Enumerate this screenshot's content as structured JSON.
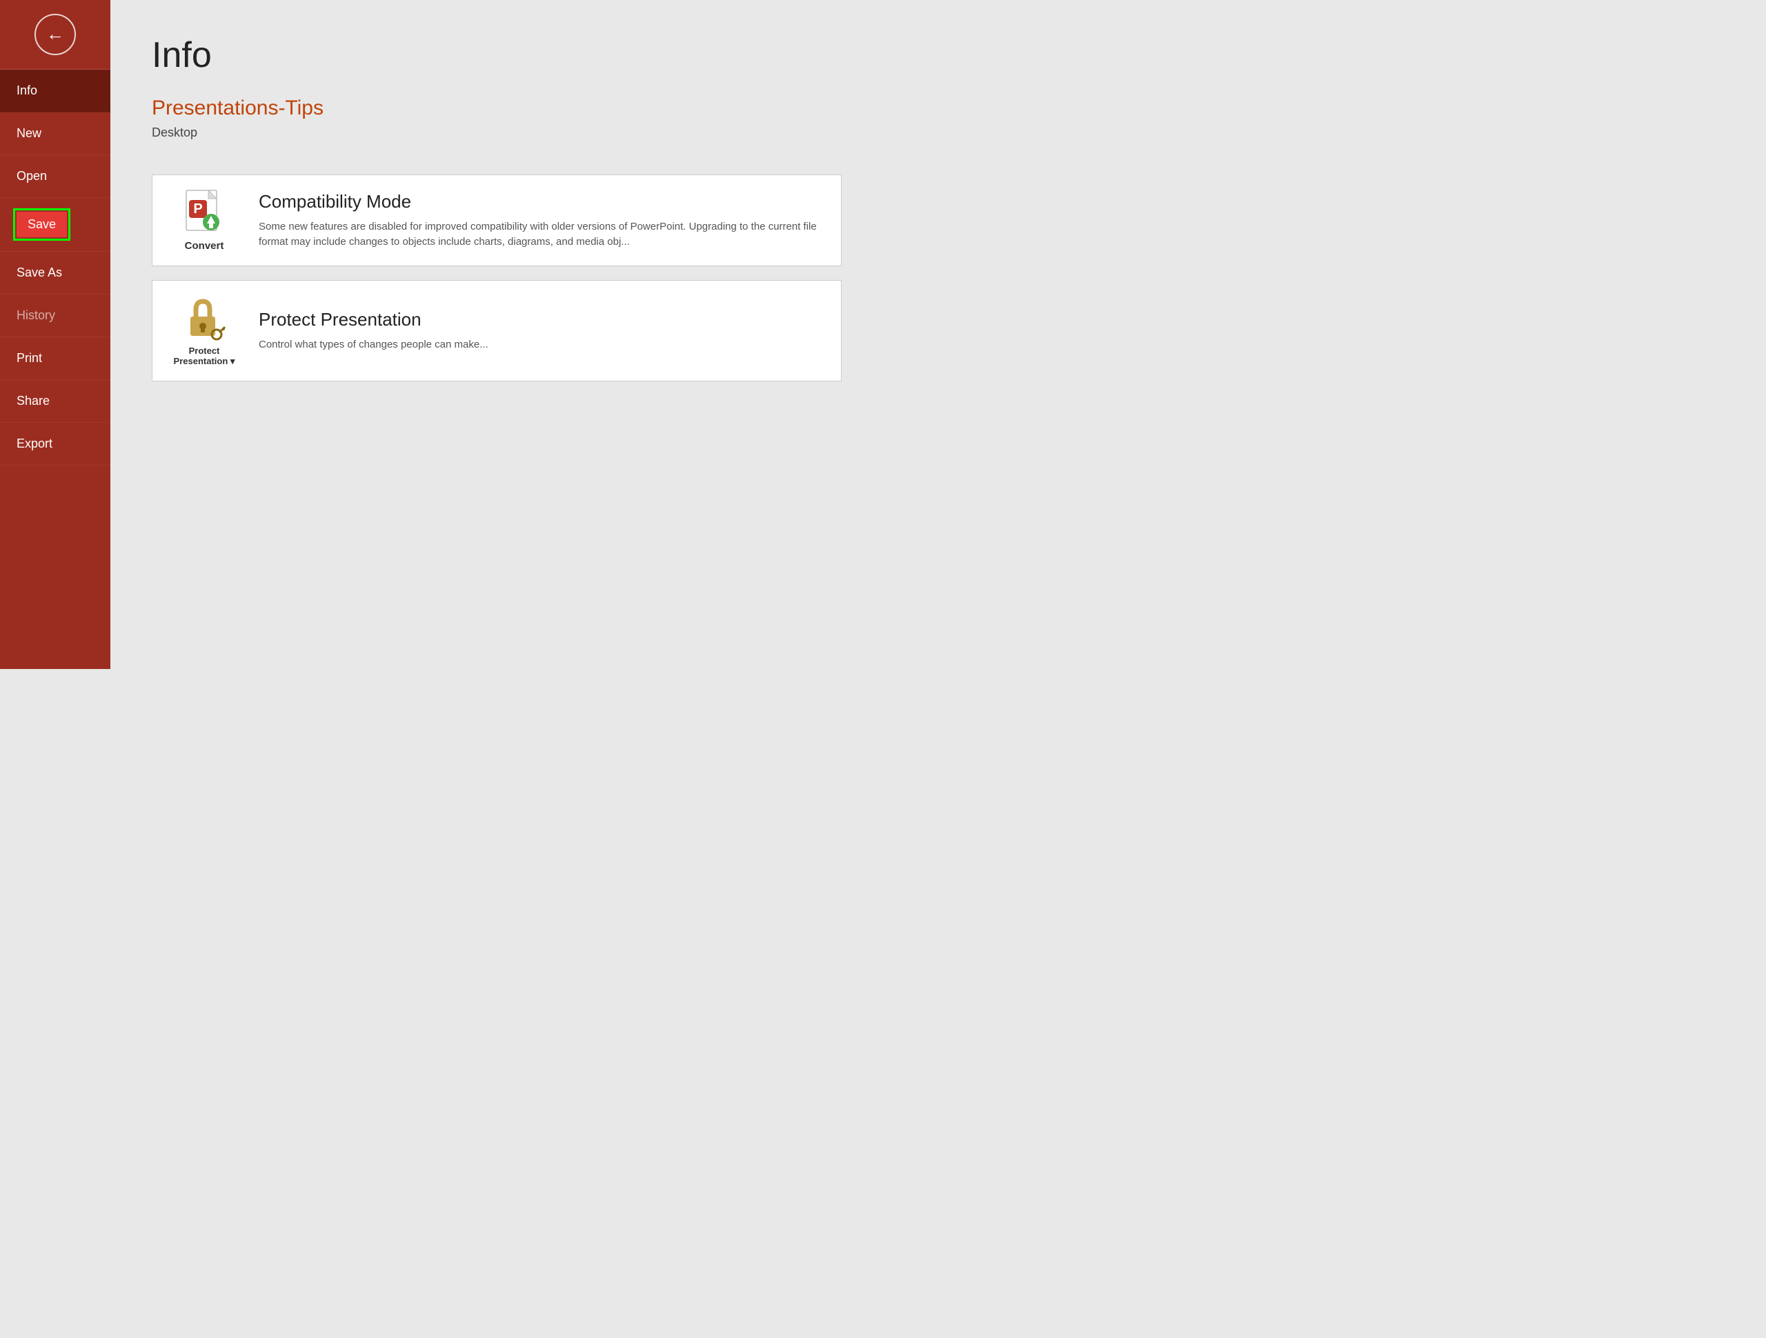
{
  "sidebar": {
    "back_button_label": "←",
    "nav_items": [
      {
        "id": "info",
        "label": "Info",
        "state": "active"
      },
      {
        "id": "new",
        "label": "New",
        "state": "normal"
      },
      {
        "id": "open",
        "label": "Open",
        "state": "normal"
      },
      {
        "id": "save",
        "label": "Save",
        "state": "highlighted"
      },
      {
        "id": "save-as",
        "label": "Save As",
        "state": "normal"
      },
      {
        "id": "history",
        "label": "History",
        "state": "dimmed"
      },
      {
        "id": "print",
        "label": "Print",
        "state": "normal"
      },
      {
        "id": "share",
        "label": "Share",
        "state": "normal"
      },
      {
        "id": "export",
        "label": "Export",
        "state": "normal"
      }
    ]
  },
  "main": {
    "page_title": "Info",
    "file_title": "Presentations-Tips",
    "file_location": "Desktop",
    "cards": [
      {
        "id": "convert",
        "icon_label": "Convert",
        "title": "Compatibility Mode",
        "description": "Some new features are disabled for improved compatibility with older versions of PowerPoint. Upgrading to the current file format may include changes to objects include charts, diagrams, and media obj..."
      },
      {
        "id": "protect",
        "icon_label": "Protect\nPresentation",
        "title": "Protect Presentation",
        "description": "Control what types of changes people can make..."
      }
    ]
  }
}
